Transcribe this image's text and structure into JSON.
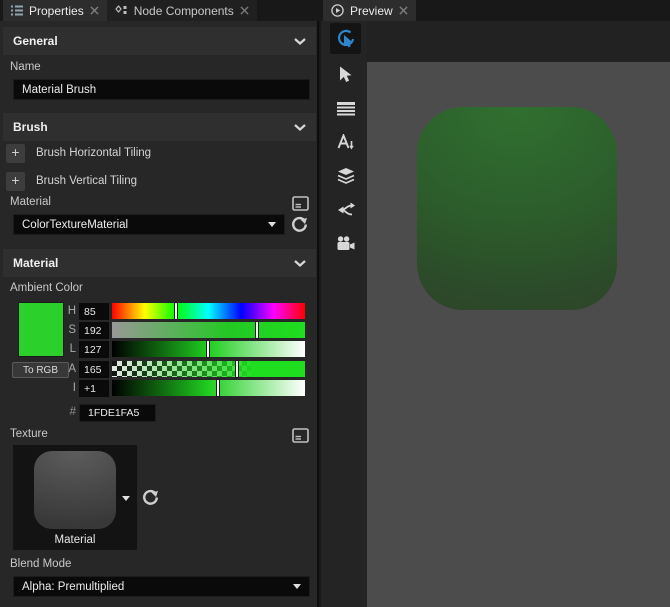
{
  "tabs": {
    "properties": "Properties",
    "node_components": "Node Components",
    "preview": "Preview"
  },
  "general": {
    "title": "General",
    "name_label": "Name",
    "name_value": "Material Brush"
  },
  "brush": {
    "title": "Brush",
    "add_rows": [
      {
        "label": "Brush Horizontal Tiling"
      },
      {
        "label": "Brush Vertical Tiling"
      }
    ],
    "material_label": "Material",
    "material_value": "ColorTextureMaterial"
  },
  "material_section": {
    "title": "Material",
    "ambient_label": "Ambient Color",
    "to_rgb_label": "To RGB",
    "sliders": [
      {
        "label": "H",
        "value": "85",
        "pct": 33.3
      },
      {
        "label": "S",
        "value": "192",
        "pct": 75.3
      },
      {
        "label": "L",
        "value": "127",
        "pct": 49.8
      },
      {
        "label": "A",
        "value": "165",
        "pct": 64.7
      },
      {
        "label": "I",
        "value": "+1",
        "pct": 55.0
      }
    ],
    "hex_prefix": "#",
    "hex_value": "1FDE1FA5"
  },
  "texture": {
    "label": "Texture",
    "thumb_caption": "Material"
  },
  "blend": {
    "label": "Blend Mode",
    "value": "Alpha: Premultiplied"
  },
  "toolbar_icons": [
    "interact-tool-icon",
    "select-arrow-icon",
    "grid-list-icon",
    "text-tool-icon",
    "layers-icon",
    "connections-icon",
    "camera-icon"
  ],
  "icons": {
    "properties_tab": "list-icon",
    "node_components_tab": "node-components-icon",
    "preview_tab": "play-circle-icon",
    "close": "close-icon",
    "section_collapse": "chevron-down-icon",
    "add": "plus-icon",
    "open_editor": "editor-window-icon",
    "revert": "circular-arrow-icon",
    "dropdown": "caret-down-icon"
  },
  "colors": {
    "swatch": "#2bd02b",
    "base_green": "#1fde1f",
    "accent_blue": "#2f86cb",
    "preview_bg": "#4c4c4c",
    "square_top": "#30702f",
    "square_bottom": "#2e4128"
  }
}
